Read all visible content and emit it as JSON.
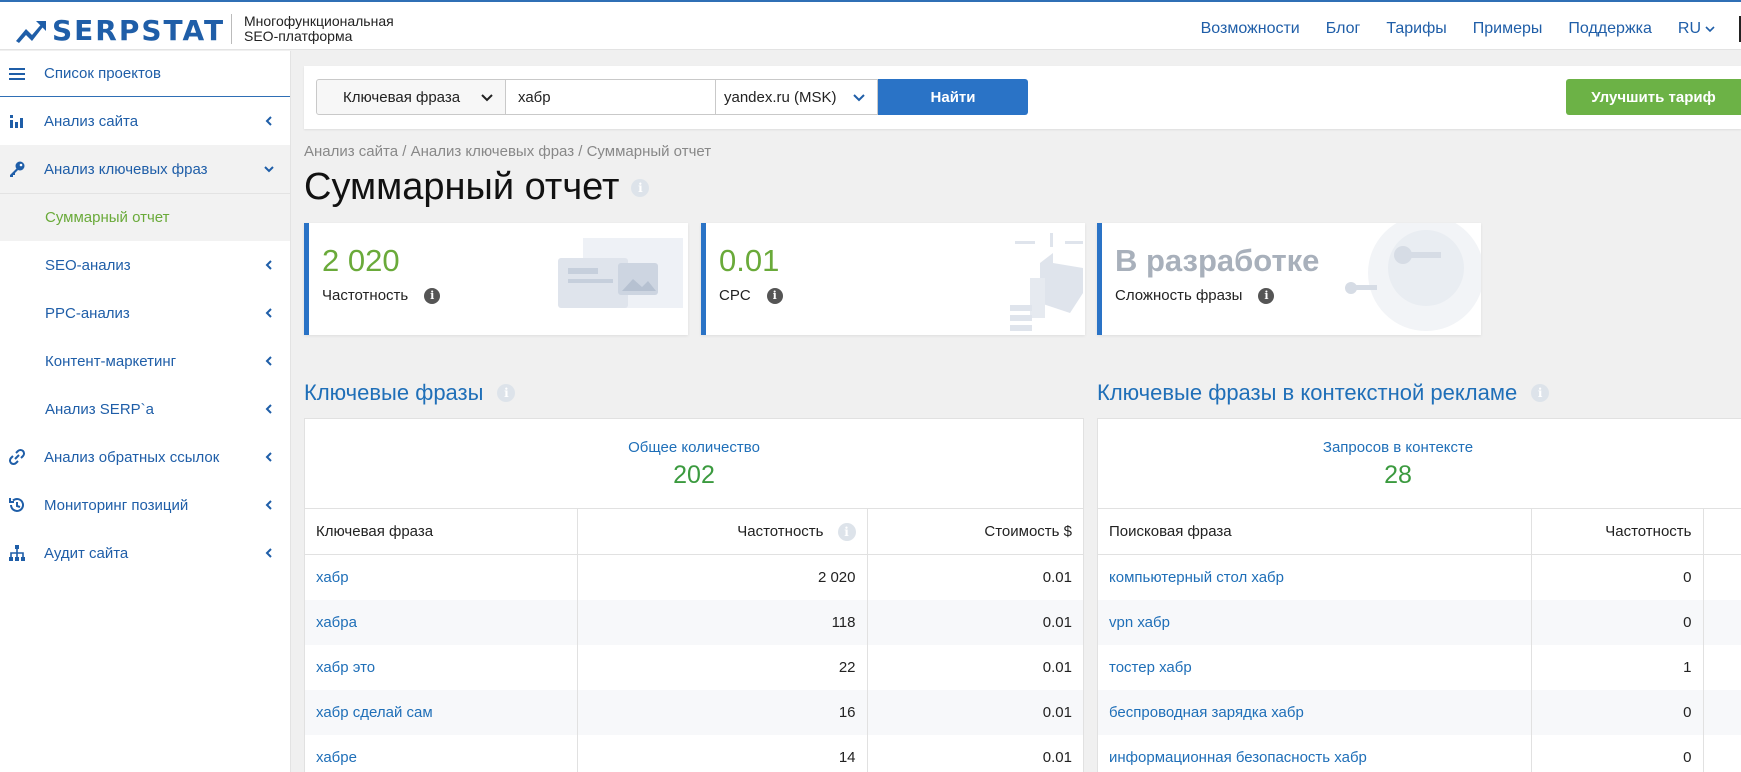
{
  "header": {
    "logo_text": "SERPSTAT",
    "tagline_line1": "Многофункциональная",
    "tagline_line2": "SEO-платформа",
    "nav": [
      "Возможности",
      "Блог",
      "Тарифы",
      "Примеры",
      "Поддержка"
    ],
    "lang": "RU"
  },
  "sidebar": {
    "projects": "Список проектов",
    "items": [
      {
        "label": "Анализ сайта",
        "icon": "bar-chart-icon"
      },
      {
        "label": "Анализ ключевых фраз",
        "icon": "key-icon"
      },
      {
        "label": "Анализ обратных ссылок",
        "icon": "link-icon"
      },
      {
        "label": "Мониторинг позиций",
        "icon": "history-icon"
      },
      {
        "label": "Аудит сайта",
        "icon": "sitemap-icon"
      }
    ],
    "subitems": [
      "Суммарный отчет",
      "SEO-анализ",
      "PPC-анализ",
      "Контент-маркетинг",
      "Анализ SERP`а"
    ]
  },
  "search": {
    "type_value": "Ключевая фраза",
    "query": "хабр",
    "database": "yandex.ru (MSK)",
    "find_label": "Найти",
    "upgrade_label": "Улучшить тариф"
  },
  "breadcrumb": "Анализ сайта / Анализ ключевых фраз / Суммарный отчет",
  "page_title": "Суммарный отчет",
  "cards": [
    {
      "value": "2 020",
      "label": "Частотность"
    },
    {
      "value": "0.01",
      "label": "CPC"
    },
    {
      "value": "В разработке",
      "label": "Сложность фразы"
    }
  ],
  "keywords": {
    "title": "Ключевые фразы",
    "total_label": "Общее количество",
    "total": "202",
    "headers": [
      "Ключевая фраза",
      "Частотность",
      "Стоимость $"
    ],
    "rows": [
      [
        "хабр",
        "2 020",
        "0.01"
      ],
      [
        "хабра",
        "118",
        "0.01"
      ],
      [
        "хабр это",
        "22",
        "0.01"
      ],
      [
        "хабр сделай сам",
        "16",
        "0.01"
      ],
      [
        "хабре",
        "14",
        "0.01"
      ]
    ]
  },
  "ppc": {
    "title": "Ключевые фразы в контекстной рекламе",
    "total_label": "Запросов в контексте",
    "total": "28",
    "headers": [
      "Поисковая фраза",
      "Частотность"
    ],
    "rows": [
      [
        "компьютерный стол хабр",
        "0"
      ],
      [
        "vpn хабр",
        "0"
      ],
      [
        "тостер хабр",
        "1"
      ],
      [
        "беспроводная зарядка хабр",
        "0"
      ],
      [
        "информационная безопасность хабр",
        "0"
      ]
    ]
  },
  "colors": {
    "accent": "#1f5ea8",
    "green": "#6cb246",
    "button_blue": "#2a73c6"
  }
}
